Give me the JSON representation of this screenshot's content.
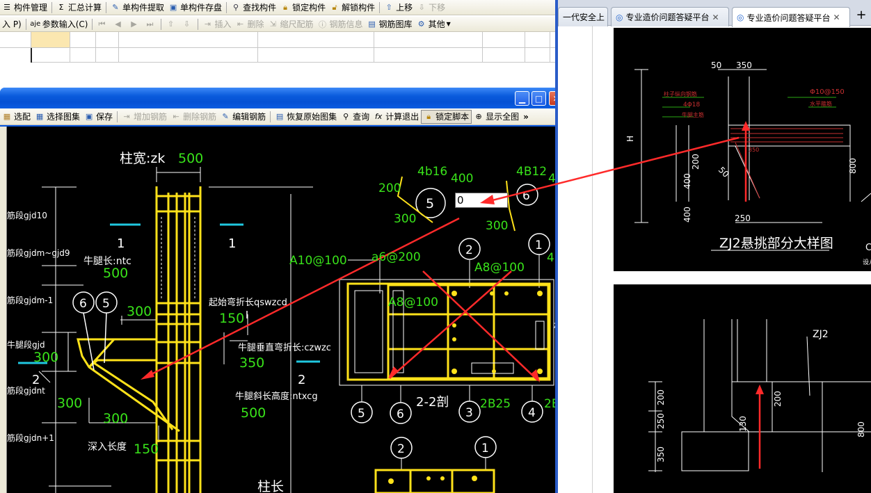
{
  "app": {
    "toolbar1": {
      "component_manage": "构件管理",
      "summary_calc": "汇总计算",
      "single_extract": "单构件提取",
      "single_save": "单构件存盘",
      "find_component": "查找构件",
      "lock_component": "锁定构件",
      "unlock_component": "解锁构件",
      "move_up": "上移",
      "move_down": "下移"
    },
    "toolbar2": {
      "p_label": "入 P)",
      "param_input": "参数输入(C)",
      "insert": "插入",
      "delete": "删除",
      "scale_rebar": "缩尺配筋",
      "rebar_info": "钢筋信息",
      "rebar_library": "钢筋图库",
      "other": "其他"
    }
  },
  "dialog": {
    "toolbar": {
      "select_match": "选配",
      "select_atlas": "选择图集",
      "save": "保存",
      "add_rebar": "增加钢筋",
      "delete_rebar": "删除钢筋",
      "edit_rebar": "编辑钢筋",
      "restore_atlas": "恢复原始图集",
      "query": "查询",
      "calc_exit": "计算退出",
      "lock_script": "锁定脚本",
      "show_full": "显示全图"
    },
    "drawing": {
      "col_width_label": "柱宽:zk",
      "col_width_val": "500",
      "seg1": "筋段gjd10",
      "seg2": "筋段gjdm~gjd9",
      "seg3": "筋段gjdm-1",
      "seg4": "牛腿段gjd",
      "seg5": "筋段gjdnt",
      "seg6": "筋段gjdn+1",
      "corbel_len": "牛腿长:ntc",
      "corbel_len_val": "500",
      "start_bend": "起始弯折长qswzcd",
      "start_bend_val": "150",
      "vert_bend": "牛腿垂直弯折长:czwzc",
      "vert_bend_val": "350",
      "slope_height": "牛腿斜长高度:ntxcg",
      "slope_height_val": "500",
      "depth": "深入长度",
      "depth_val": "150",
      "col_len": "柱长",
      "sec_label": "2-2剖",
      "v300a": "300",
      "v300b": "300",
      "v300c": "300",
      "v300d": "300",
      "v150b": "150",
      "num1a": "1",
      "num1b": "1",
      "num2a": "2",
      "num2b": "2",
      "b6": "6",
      "b5": "5",
      "r4b16": "4b16",
      "r4B12": "4B12",
      "v400": "400",
      "v40": "40",
      "v200": "200",
      "v300s": "300",
      "v300t": "300",
      "input_val": "0",
      "b5s": "5",
      "b6s": "6",
      "A10": "A10@100",
      "a6": "a6@200",
      "A8a": "A8@100",
      "A8b": "A8@100",
      "r4B": "4B",
      "s2": "2",
      "s1": "1",
      "c5": "5",
      "c6": "6",
      "c3": "3",
      "c4": "4",
      "c2B25a": "2B25",
      "c2B25b": "2B2",
      "d2": "2",
      "d1": "1",
      "mid_char": "柱",
      "mid_5": "5"
    }
  },
  "browser": {
    "tabs": [
      {
        "label": "一代安全上"
      },
      {
        "label": "专业造价问题答疑平台"
      },
      {
        "label": "专业造价问题答疑平台"
      }
    ],
    "new_tab": "+",
    "img1": {
      "d50": "50",
      "d350": "350",
      "phi": "Φ10@150",
      "note1": "柱子纵向钢筋",
      "note2": "4Φ18",
      "note3": "水平箍筋",
      "note4": "牛腿主筋",
      "h": "H",
      "v400a": "400",
      "v200": "200",
      "v400b": "400",
      "v50": "50",
      "v800": "800",
      "v250": "250",
      "v350": "350",
      "title": "ZJ2悬挑部分大样图",
      "c": "C",
      "side": "设八"
    },
    "img2": {
      "label": "ZJ2",
      "v200": "200",
      "v250": "250",
      "v350": "350",
      "v130": "130",
      "v200b": "200",
      "v800": "800"
    }
  }
}
